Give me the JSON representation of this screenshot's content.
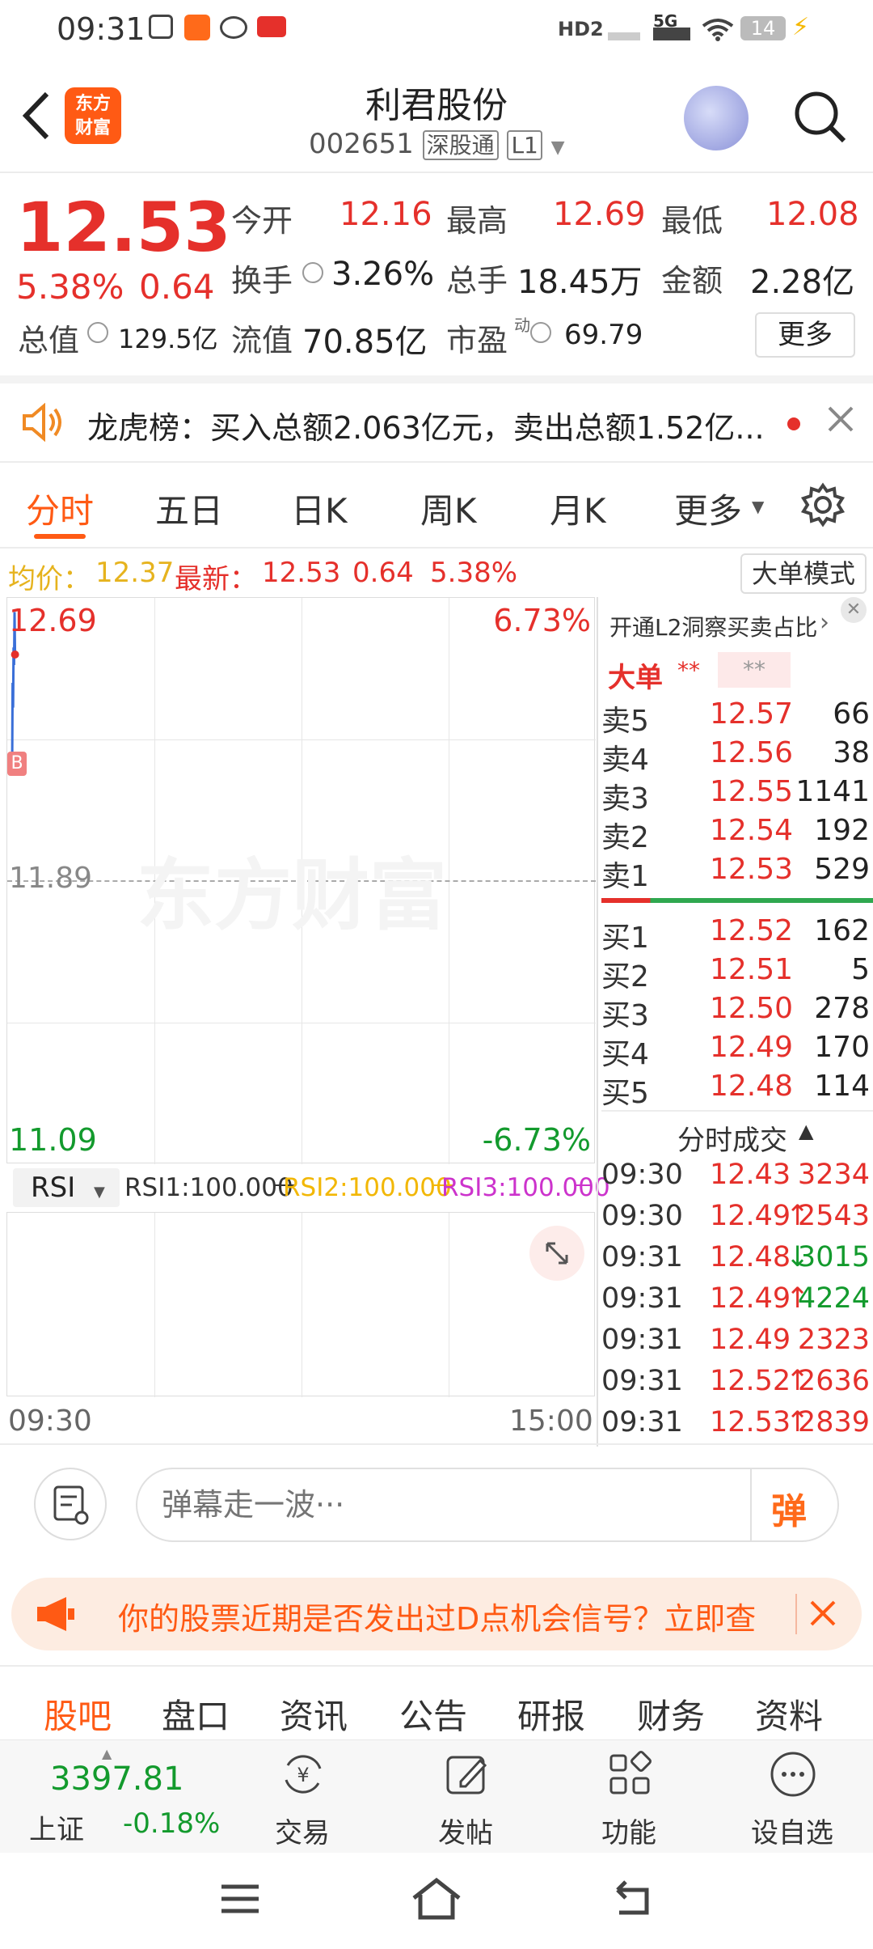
{
  "status": {
    "time": "09:31",
    "network": "5G",
    "signal_label": "HD2",
    "battery": "14"
  },
  "header": {
    "title": "利君股份",
    "code": "002651",
    "market_tag": "深股通",
    "level_tag": "L1",
    "logo_line1": "东方",
    "logo_line2": "财富"
  },
  "quote": {
    "price": "12.53",
    "change_pct": "5.38%",
    "change_abs": "0.64",
    "open_label": "今开",
    "open": "12.16",
    "high_label": "最高",
    "high": "12.69",
    "low_label": "最低",
    "low": "12.08",
    "turnover_label": "换手",
    "turnover": "3.26%",
    "volume_label": "总手",
    "volume": "18.45万",
    "amount_label": "金额",
    "amount": "2.28亿",
    "mktcap_label": "总值",
    "mktcap": "129.5亿",
    "float_label": "流值",
    "float_cap": "70.85亿",
    "pe_label": "市盈",
    "pe_sup": "动",
    "pe": "69.79",
    "more_label": "更多"
  },
  "notice": {
    "text": "龙虎榜：买入总额2.063亿元，卖出总额1.52亿..."
  },
  "tabs": [
    {
      "label": "分时",
      "active": true
    },
    {
      "label": "五日"
    },
    {
      "label": "日K"
    },
    {
      "label": "周K"
    },
    {
      "label": "月K"
    },
    {
      "label": "更多"
    }
  ],
  "chart_info": {
    "avg_label": "均价：",
    "avg": "12.37",
    "last_label": "最新：",
    "last": "12.53",
    "chg": "0.64",
    "chg_pct": "5.38%",
    "mode_button": "大单模式"
  },
  "chart_data": {
    "type": "line",
    "y_top": "12.69",
    "y_mid": "11.89",
    "y_bottom": "11.09",
    "pct_top": "6.73%",
    "pct_bottom": "-6.73%",
    "x_start": "09:30",
    "x_end": "15:00",
    "ylim": [
      11.09,
      12.69
    ],
    "series": [
      {
        "values": [
          12.2,
          12.45,
          12.38,
          12.55,
          12.5,
          12.65,
          12.53
        ]
      }
    ],
    "marker": "B",
    "watermark": "东方财富"
  },
  "indicator": {
    "name": "RSI",
    "rsi1": "RSI1:100.000",
    "rsi2": "RSI2:100.000",
    "rsi3": "RSI3:100.000"
  },
  "orderbook": {
    "l2_promo": "开通L2洞察买卖占比",
    "big_order_label": "大单",
    "big_order_val1": "**",
    "big_order_val2": "**",
    "asks": [
      {
        "label": "卖5",
        "price": "12.57",
        "vol": "66"
      },
      {
        "label": "卖4",
        "price": "12.56",
        "vol": "38"
      },
      {
        "label": "卖3",
        "price": "12.55",
        "vol": "1141"
      },
      {
        "label": "卖2",
        "price": "12.54",
        "vol": "192"
      },
      {
        "label": "卖1",
        "price": "12.53",
        "vol": "529"
      }
    ],
    "bids": [
      {
        "label": "买1",
        "price": "12.52",
        "vol": "162"
      },
      {
        "label": "买2",
        "price": "12.51",
        "vol": "5"
      },
      {
        "label": "买3",
        "price": "12.50",
        "vol": "278"
      },
      {
        "label": "买4",
        "price": "12.49",
        "vol": "170"
      },
      {
        "label": "买5",
        "price": "12.48",
        "vol": "114"
      }
    ]
  },
  "ticks": {
    "title": "分时成交",
    "rows": [
      {
        "time": "09:30",
        "price": "12.43",
        "dir": "",
        "vol": "3234"
      },
      {
        "time": "09:30",
        "price": "12.49",
        "dir": "↑",
        "vol": "2543"
      },
      {
        "time": "09:31",
        "price": "12.48",
        "dir": "↓",
        "vol": "3015"
      },
      {
        "time": "09:31",
        "price": "12.49",
        "dir": "↑",
        "vol": "4224"
      },
      {
        "time": "09:31",
        "price": "12.49",
        "dir": "",
        "vol": "2323"
      },
      {
        "time": "09:31",
        "price": "12.52",
        "dir": "↑",
        "vol": "2636"
      },
      {
        "time": "09:31",
        "price": "12.53",
        "dir": "↑",
        "vol": "2839"
      }
    ]
  },
  "danmaku": {
    "placeholder": "弹幕走一波···",
    "send_label": "弹"
  },
  "promo": {
    "text": "你的股票近期是否发出过D点机会信号？立即查"
  },
  "footer_tabs": [
    "股吧",
    "盘口",
    "资讯",
    "公告",
    "研报",
    "财务",
    "资料"
  ],
  "bottom_nav": {
    "index_value": "3397.81",
    "index_name": "上证",
    "index_change": "-0.18%",
    "items": [
      "交易",
      "发帖",
      "功能",
      "设自选"
    ]
  }
}
